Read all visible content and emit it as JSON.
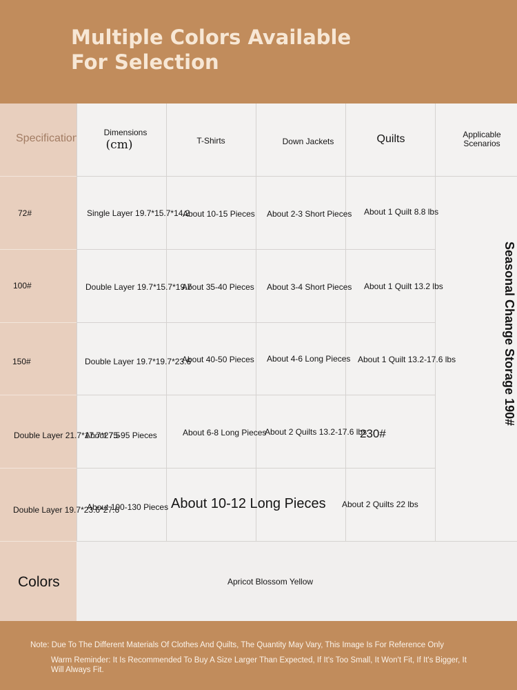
{
  "header": {
    "title": "Multiple Colors Available For Selection"
  },
  "table": {
    "spec_label": "Specifications",
    "col_dimensions": "Dimensions",
    "col_dimensions_unit": "(cm)",
    "col_tshirts": "T-Shirts",
    "col_down": "Down Jackets",
    "col_quilts": "Quilts",
    "col_scenarios": "Applicable Scenarios",
    "rows": [
      {
        "spec": "72#",
        "dimensions": "Single Layer 19.7*15.7*14.2",
        "tshirts": "About 10-15 Pieces",
        "down": "About 2-3 Short Pieces",
        "quilts": "About 1 Quilt 8.8 lbs"
      },
      {
        "spec": "100#",
        "dimensions": "Double Layer 19.7*15.7*19.7",
        "tshirts": "About 35-40 Pieces",
        "down": "About 3-4 Short Pieces",
        "quilts": "About 1 Quilt 13.2 lbs"
      },
      {
        "spec": "150#",
        "dimensions": "Double Layer 19.7*19.7*23.6",
        "tshirts": "About 40-50 Pieces",
        "down": "About 4-6 Long Pieces",
        "quilts": "About 1 Quilt 13.2-17.6 lbs"
      },
      {
        "spec": "Double Layer 21.7*17.7*27.5",
        "dimensions": "About 75-95 Pieces",
        "tshirts": "About 6-8 Long Pieces",
        "down": "About 2 Quilts 13.2-17.6 lbs",
        "quilts": "230#"
      },
      {
        "spec": "Double Layer 19.7*23.6*27.6",
        "dimensions": "About 100-130 Pieces",
        "tshirts": "About 10-12 Long Pieces",
        "down": "About 2 Quilts 22 lbs"
      }
    ],
    "scenario": "Seasonal Change Storage 190#",
    "colors_label": "Colors",
    "colors_value": "Apricot Blossom Yellow"
  },
  "footer": {
    "note": "Note: Due To The Different Materials Of Clothes And Quilts, The Quantity May Vary, This Image Is For Reference Only",
    "reminder": "Warm Reminder: It Is Recommended To Buy A Size Larger Than Expected, If It's Too Small, It Won't Fit, If It's Bigger, It Will Always Fit."
  }
}
